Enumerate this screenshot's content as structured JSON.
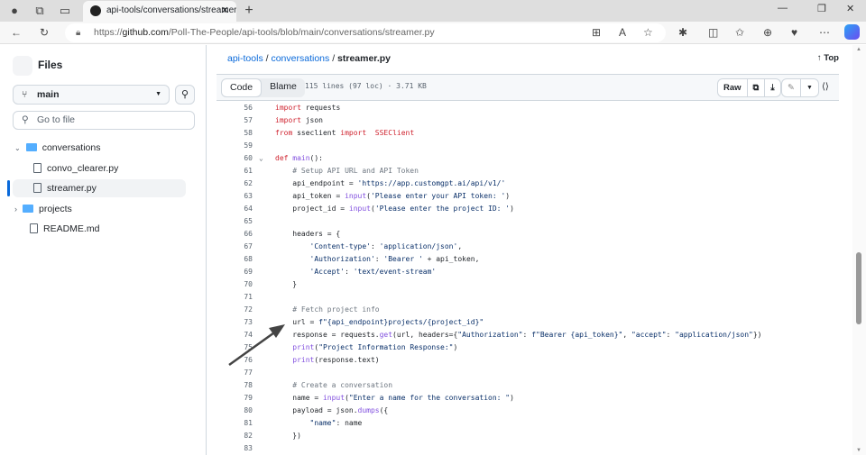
{
  "browser": {
    "tab_title": "api-tools/conversations/streamer.py",
    "url_prefix": "https://",
    "url_host": "github.com",
    "url_path": "/Poll-The-People/api-tools/blob/main/conversations/streamer.py"
  },
  "sidebar": {
    "title": "Files",
    "branch": "main",
    "goto_placeholder": "Go to file",
    "tree": [
      {
        "label": "conversations",
        "type": "folder",
        "expanded": true,
        "depth": 0
      },
      {
        "label": "convo_clearer.py",
        "type": "file",
        "depth": 1
      },
      {
        "label": "streamer.py",
        "type": "file",
        "depth": 1,
        "selected": true
      },
      {
        "label": "projects",
        "type": "folder",
        "expanded": false,
        "depth": 0
      },
      {
        "label": "README.md",
        "type": "file",
        "depth": 0
      }
    ]
  },
  "breadcrumb": {
    "repo": "api-tools",
    "folder": "conversations",
    "file": "streamer.py",
    "sep": "/"
  },
  "top_label": "Top",
  "toolbar": {
    "code": "Code",
    "blame": "Blame",
    "meta": "115 lines (97 loc) · 3.71 KB",
    "raw": "Raw"
  },
  "code": [
    {
      "n": "56",
      "t": [
        [
          "kw",
          "import"
        ],
        [
          "",
          "requests"
        ]
      ]
    },
    {
      "n": "57",
      "t": [
        [
          "kw",
          "import"
        ],
        [
          "",
          "json"
        ]
      ]
    },
    {
      "n": "58",
      "t": [
        [
          "kw",
          "from"
        ],
        [
          "",
          " sseclient "
        ],
        [
          "kw",
          "import"
        ],
        [
          "",
          ""
        ],
        [
          "kw",
          " SSEClient"
        ]
      ]
    },
    {
      "n": "59",
      "t": []
    },
    {
      "n": "60",
      "fold": true,
      "t": [
        [
          "kw",
          "def"
        ],
        [
          "",
          " "
        ],
        [
          "fn",
          "main"
        ],
        [
          "",
          "():"
        ]
      ]
    },
    {
      "n": "61",
      "t": [
        [
          "",
          "    "
        ],
        [
          "cm",
          "# Setup API URL and API Token"
        ]
      ]
    },
    {
      "n": "62",
      "t": [
        [
          "",
          "    api_endpoint = "
        ],
        [
          "str",
          "'https://app.customgpt.ai/api/v1/'"
        ]
      ]
    },
    {
      "n": "63",
      "t": [
        [
          "",
          "    api_token = "
        ],
        [
          "fn",
          "input"
        ],
        [
          "",
          "("
        ],
        [
          "str",
          "'Please enter your API token: '"
        ],
        [
          "",
          ")"
        ]
      ]
    },
    {
      "n": "64",
      "t": [
        [
          "",
          "    project_id = "
        ],
        [
          "fn",
          "input"
        ],
        [
          "",
          "("
        ],
        [
          "str",
          "'Please enter the project ID: '"
        ],
        [
          "",
          ")"
        ]
      ]
    },
    {
      "n": "65",
      "t": []
    },
    {
      "n": "66",
      "t": [
        [
          "",
          "    headers = {"
        ]
      ]
    },
    {
      "n": "67",
      "t": [
        [
          "",
          "        "
        ],
        [
          "str",
          "'Content-type'"
        ],
        [
          "",
          ": "
        ],
        [
          "str",
          "'application/json'"
        ],
        [
          "",
          ","
        ]
      ]
    },
    {
      "n": "68",
      "t": [
        [
          "",
          "        "
        ],
        [
          "str",
          "'Authorization'"
        ],
        [
          "",
          ": "
        ],
        [
          "str",
          "'Bearer '"
        ],
        [
          "",
          " + api_token,"
        ]
      ]
    },
    {
      "n": "69",
      "t": [
        [
          "",
          "        "
        ],
        [
          "str",
          "'Accept'"
        ],
        [
          "",
          ": "
        ],
        [
          "str",
          "'text/event-stream'"
        ]
      ]
    },
    {
      "n": "70",
      "t": [
        [
          "",
          "    }"
        ]
      ]
    },
    {
      "n": "71",
      "t": []
    },
    {
      "n": "72",
      "t": [
        [
          "",
          "    "
        ],
        [
          "cm",
          "# Fetch project info"
        ]
      ]
    },
    {
      "n": "73",
      "t": [
        [
          "",
          "    url = "
        ],
        [
          "str",
          "f\"{api_endpoint}projects/{project_id}\""
        ]
      ]
    },
    {
      "n": "74",
      "t": [
        [
          "",
          "    response = requests."
        ],
        [
          "fn",
          "get"
        ],
        [
          "",
          "(url, headers={"
        ],
        [
          "str",
          "\"Authorization\""
        ],
        [
          "",
          ": "
        ],
        [
          "str",
          "f\"Bearer {api_token}\""
        ],
        [
          "",
          ", "
        ],
        [
          "str",
          "\"accept\""
        ],
        [
          "",
          ": "
        ],
        [
          "str",
          "\"application/json\""
        ],
        [
          "",
          "})"
        ]
      ]
    },
    {
      "n": "75",
      "t": [
        [
          "",
          "    "
        ],
        [
          "fn",
          "print"
        ],
        [
          "",
          "("
        ],
        [
          "str",
          "\"Project Information Response:\""
        ],
        [
          "",
          ")"
        ]
      ]
    },
    {
      "n": "76",
      "t": [
        [
          "",
          "    "
        ],
        [
          "fn",
          "print"
        ],
        [
          "",
          "(response.text)"
        ]
      ]
    },
    {
      "n": "77",
      "t": []
    },
    {
      "n": "78",
      "t": [
        [
          "",
          "    "
        ],
        [
          "cm",
          "# Create a conversation"
        ]
      ]
    },
    {
      "n": "79",
      "t": [
        [
          "",
          "    name = "
        ],
        [
          "fn",
          "input"
        ],
        [
          "",
          "("
        ],
        [
          "str",
          "\"Enter a name for the conversation: \""
        ],
        [
          "",
          ")"
        ]
      ]
    },
    {
      "n": "80",
      "t": [
        [
          "",
          "    payload = json."
        ],
        [
          "fn",
          "dumps"
        ],
        [
          "",
          "({"
        ]
      ]
    },
    {
      "n": "81",
      "t": [
        [
          "",
          "        "
        ],
        [
          "str",
          "\"name\""
        ],
        [
          "",
          ": name"
        ]
      ]
    },
    {
      "n": "82",
      "t": [
        [
          "",
          "    })"
        ]
      ]
    },
    {
      "n": "83",
      "t": []
    }
  ]
}
